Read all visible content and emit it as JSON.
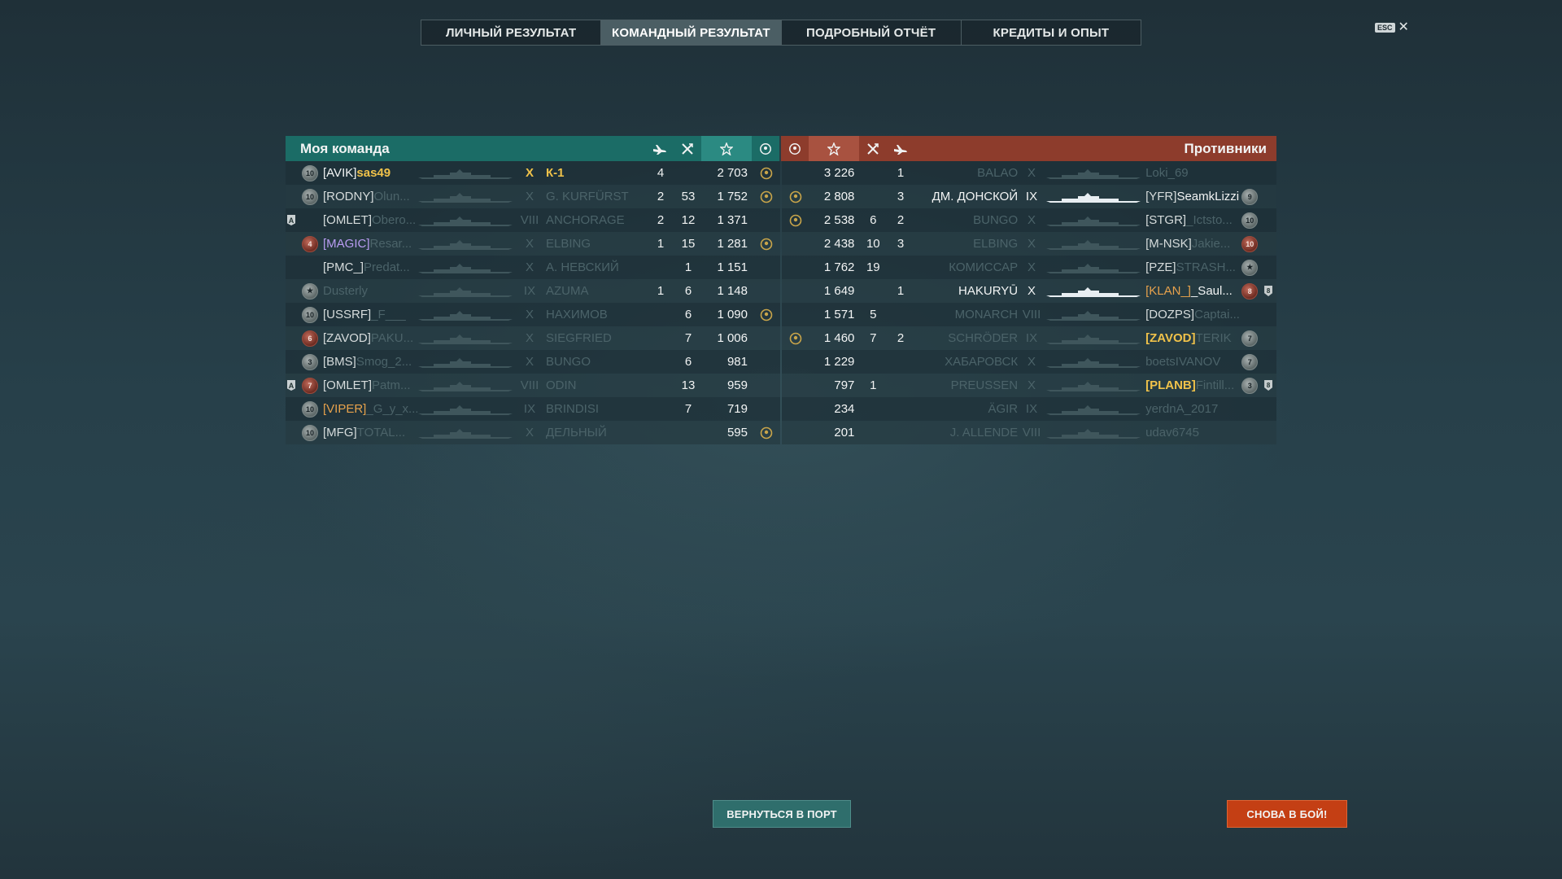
{
  "tabs": [
    {
      "label": "ЛИЧНЫЙ РЕЗУЛЬТАТ",
      "active": false
    },
    {
      "label": "КОМАНДНЫЙ РЕЗУЛЬТАТ",
      "active": true
    },
    {
      "label": "ПОДРОБНЫЙ ОТЧЁТ",
      "active": false
    },
    {
      "label": "КРЕДИТЫ И ОПЫТ",
      "active": false
    }
  ],
  "esc": {
    "key": "ESC",
    "close": "✕"
  },
  "my_team": {
    "title": "Моя команда",
    "rows": [
      {
        "mark": "",
        "badge": "10",
        "badge_red": false,
        "clan": "[AVIK]",
        "clan_style": "white",
        "name": "sas49",
        "name_style": "gold",
        "tier": "X",
        "ship": "К-1",
        "ship_style": "gold",
        "planes": "4",
        "kills": "",
        "score": "2 703",
        "laurel": true
      },
      {
        "mark": "",
        "badge": "10",
        "badge_red": false,
        "clan": "[RODNY]",
        "clan_style": "clan",
        "name": "Olun...",
        "name_style": "dim",
        "tier": "X",
        "ship": "G. KURFÜRST",
        "ship_style": "dim",
        "planes": "2",
        "kills": "53",
        "score": "1 752",
        "laurel": true
      },
      {
        "mark": "A",
        "badge": "",
        "badge_red": false,
        "clan": "[OMLET]",
        "clan_style": "clan",
        "name": "Obero...",
        "name_style": "dim",
        "tier": "VIII",
        "ship": "ANCHORAGE",
        "ship_style": "dim",
        "planes": "2",
        "kills": "12",
        "score": "1 371",
        "laurel": false
      },
      {
        "mark": "",
        "badge": "4",
        "badge_red": true,
        "clan": "[MAGIC]",
        "clan_style": "purple",
        "name": "Resar...",
        "name_style": "dim",
        "tier": "X",
        "ship": "ELBING",
        "ship_style": "dim",
        "planes": "1",
        "kills": "15",
        "score": "1 281",
        "laurel": true
      },
      {
        "mark": "",
        "badge": "",
        "badge_red": false,
        "clan": "[PMC_]",
        "clan_style": "clan",
        "name": "Predat...",
        "name_style": "dim",
        "tier": "X",
        "ship": "А. НЕВСКИЙ",
        "ship_style": "dim",
        "planes": "",
        "kills": "1",
        "score": "1 151",
        "laurel": false
      },
      {
        "mark": "",
        "badge": "★",
        "badge_red": false,
        "clan": "",
        "clan_style": "clan",
        "name": "Dusterly",
        "name_style": "dim",
        "tier": "IX",
        "ship": "AZUMA",
        "ship_style": "dim",
        "planes": "1",
        "kills": "6",
        "score": "1 148",
        "laurel": false
      },
      {
        "mark": "",
        "badge": "10",
        "badge_red": false,
        "clan": "[USSRF]",
        "clan_style": "clan",
        "name": "_F___",
        "name_style": "dim",
        "tier": "X",
        "ship": "НАХИМОВ",
        "ship_style": "dim",
        "planes": "",
        "kills": "6",
        "score": "1 090",
        "laurel": true
      },
      {
        "mark": "",
        "badge": "6",
        "badge_red": true,
        "clan": "[ZAVOD]",
        "clan_style": "clan",
        "name": "PAKU...",
        "name_style": "dim",
        "tier": "X",
        "ship": "SIEGFRIED",
        "ship_style": "dim",
        "planes": "",
        "kills": "7",
        "score": "1 006",
        "laurel": false
      },
      {
        "mark": "",
        "badge": "3",
        "badge_red": false,
        "clan": "[BMS]",
        "clan_style": "clan",
        "name": "Smog_2...",
        "name_style": "dim",
        "tier": "X",
        "ship": "BUNGO",
        "ship_style": "dim",
        "planes": "",
        "kills": "6",
        "score": "981",
        "laurel": false
      },
      {
        "mark": "A",
        "badge": "7",
        "badge_red": true,
        "clan": "[OMLET]",
        "clan_style": "clan",
        "name": "Patm...",
        "name_style": "dim",
        "tier": "VIII",
        "ship": "ODIN",
        "ship_style": "dim",
        "planes": "",
        "kills": "13",
        "score": "959",
        "laurel": false
      },
      {
        "mark": "",
        "badge": "10",
        "badge_red": false,
        "clan": "[VIPER]",
        "clan_style": "orange",
        "name": "_G_y_x...",
        "name_style": "dim",
        "tier": "IX",
        "ship": "BRINDISI",
        "ship_style": "dim",
        "planes": "",
        "kills": "7",
        "score": "719",
        "laurel": false
      },
      {
        "mark": "",
        "badge": "10",
        "badge_red": false,
        "clan": "[MFG]",
        "clan_style": "clan",
        "name": "TOTAL...",
        "name_style": "dim",
        "tier": "X",
        "ship": "ДЕЛЬНЫЙ",
        "ship_style": "dim",
        "planes": "",
        "kills": "",
        "score": "595",
        "laurel": true
      }
    ]
  },
  "enemy_team": {
    "title": "Противники",
    "rows": [
      {
        "laurel": false,
        "score": "3 226",
        "kills": "",
        "planes": "1",
        "ship": "BALAO",
        "ship_style": "dim",
        "tier": "X",
        "clan": "",
        "clan_style": "clan",
        "name": "Loki_69",
        "name_style": "dim",
        "badge": "",
        "badge_red": false,
        "shield": ""
      },
      {
        "laurel": true,
        "score": "2 808",
        "kills": "",
        "planes": "3",
        "ship": "ДМ. ДОНСКОЙ",
        "ship_style": "white",
        "tier": "IX",
        "clan": "[YFR]",
        "clan_style": "clan",
        "name": "SeamkLizzi",
        "name_style": "white",
        "badge": "9",
        "badge_red": false,
        "shield": ""
      },
      {
        "laurel": true,
        "score": "2 538",
        "kills": "6",
        "planes": "2",
        "ship": "BUNGO",
        "ship_style": "dim",
        "tier": "X",
        "clan": "[STGR]",
        "clan_style": "clan",
        "name": "_Ictsto...",
        "name_style": "dim",
        "badge": "10",
        "badge_red": false,
        "shield": ""
      },
      {
        "laurel": false,
        "score": "2 438",
        "kills": "10",
        "planes": "3",
        "ship": "ELBING",
        "ship_style": "dim",
        "tier": "X",
        "clan": "[M-NSK]",
        "clan_style": "clan",
        "name": "Jakie...",
        "name_style": "dim",
        "badge": "10",
        "badge_red": true,
        "shield": ""
      },
      {
        "laurel": false,
        "score": "1 762",
        "kills": "19",
        "planes": "",
        "ship": "КОМИССАР",
        "ship_style": "dim",
        "tier": "X",
        "clan": "[PZE]",
        "clan_style": "clan",
        "name": "STRASH...",
        "name_style": "dim",
        "badge": "★",
        "badge_red": false,
        "shield": ""
      },
      {
        "laurel": false,
        "score": "1 649",
        "kills": "",
        "planes": "1",
        "ship": "HAKURYŪ",
        "ship_style": "white",
        "tier": "X",
        "clan": "[KLAN_]",
        "clan_style": "orange",
        "name": "_Saul...",
        "name_style": "white",
        "badge": "8",
        "badge_red": true,
        "shield": "8"
      },
      {
        "laurel": false,
        "score": "1 571",
        "kills": "5",
        "planes": "",
        "ship": "MONARCH",
        "ship_style": "dim",
        "tier": "VIII",
        "clan": "[DOZPS]",
        "clan_style": "clan",
        "name": "Captai...",
        "name_style": "dim",
        "badge": "",
        "badge_red": false,
        "shield": ""
      },
      {
        "laurel": true,
        "score": "1 460",
        "kills": "7",
        "planes": "2",
        "ship": "SCHRÖDER",
        "ship_style": "dim",
        "tier": "IX",
        "clan": "[ZAVOD]",
        "clan_style": "gold-clan",
        "name": "TERIK",
        "name_style": "dim",
        "badge": "7",
        "badge_red": false,
        "shield": ""
      },
      {
        "laurel": false,
        "score": "1 229",
        "kills": "",
        "planes": "",
        "ship": "ХАБАРОВСК",
        "ship_style": "dim",
        "tier": "X",
        "clan": "",
        "clan_style": "clan",
        "name": "boetsIVANOV",
        "name_style": "dim",
        "badge": "7",
        "badge_red": false,
        "shield": ""
      },
      {
        "laurel": false,
        "score": "797",
        "kills": "1",
        "planes": "",
        "ship": "PREUSSEN",
        "ship_style": "dim",
        "tier": "X",
        "clan": "[PLANB]",
        "clan_style": "gold-clan",
        "name": "Fintill...",
        "name_style": "dim",
        "badge": "3",
        "badge_red": false,
        "shield": "8"
      },
      {
        "laurel": false,
        "score": "234",
        "kills": "",
        "planes": "",
        "ship": "ÄGIR",
        "ship_style": "dim",
        "tier": "IX",
        "clan": "",
        "clan_style": "clan",
        "name": "yerdnA_2017",
        "name_style": "dim",
        "badge": "",
        "badge_red": false,
        "shield": ""
      },
      {
        "laurel": false,
        "score": "201",
        "kills": "",
        "planes": "",
        "ship": "J. ALLENDE",
        "ship_style": "dim",
        "tier": "VIII",
        "clan": "",
        "clan_style": "clan",
        "name": "udav6745",
        "name_style": "dim",
        "badge": "",
        "badge_red": false,
        "shield": ""
      }
    ]
  },
  "buttons": {
    "port": "ВЕРНУТЬСЯ В ПОРТ",
    "fight": "СНОВА В БОЙ!"
  },
  "colors": {
    "team_header": "#1b6c66",
    "enemy_header": "#8d3c2c",
    "fight_button": "#c43f14",
    "port_button": "#2f6e6c",
    "highlight": "#f0c24a"
  }
}
